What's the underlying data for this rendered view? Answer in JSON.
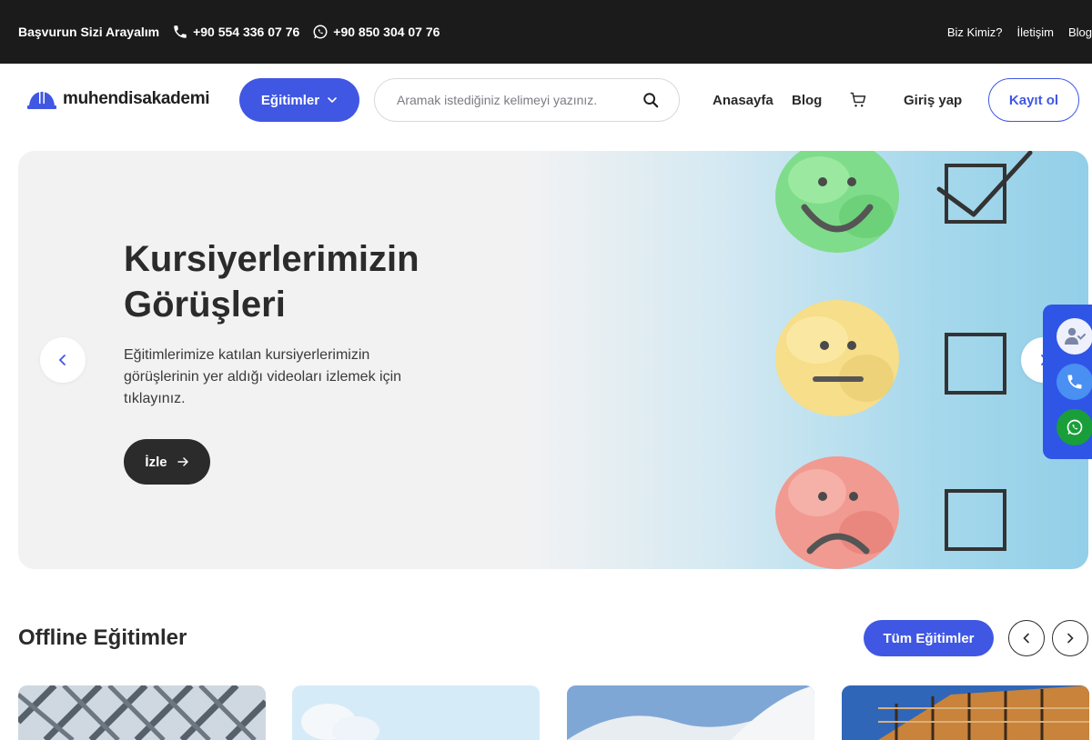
{
  "topbar": {
    "apply_label": "Başvurun Sizi Arayalım",
    "phone": "+90 554 336 07 76",
    "whatsapp": "+90 850 304 07 76",
    "links": [
      "Biz Kimiz?",
      "İletişim",
      "Blog"
    ]
  },
  "header": {
    "logo_text": "muhendisakademi",
    "courses_button": "Eğitimler",
    "search_placeholder": "Aramak istediğiniz kelimeyi yazınız.",
    "nav": [
      "Anasayfa",
      "Blog"
    ],
    "login": "Giriş yap",
    "register": "Kayıt ol"
  },
  "hero": {
    "title": "Kursiyerlerimizin Görüşleri",
    "description": "Eğitimlerimize katılan kursiyerlerimizin görüşlerinin yer aldığı videoları izlemek için tıklayınız.",
    "watch_button": "İzle"
  },
  "section": {
    "title": "Offline Eğitimler",
    "all_button": "Tüm Eğitimler"
  },
  "colors": {
    "primary": "#4057e3",
    "dark": "#1b1b1b",
    "whatsapp": "#1a9e3a",
    "float_bar": "#2f55e6"
  },
  "icons": {
    "phone": "phone-icon",
    "whatsapp": "whatsapp-icon",
    "search": "search-icon",
    "cart": "cart-icon",
    "chevron": "chevron-down-icon"
  }
}
